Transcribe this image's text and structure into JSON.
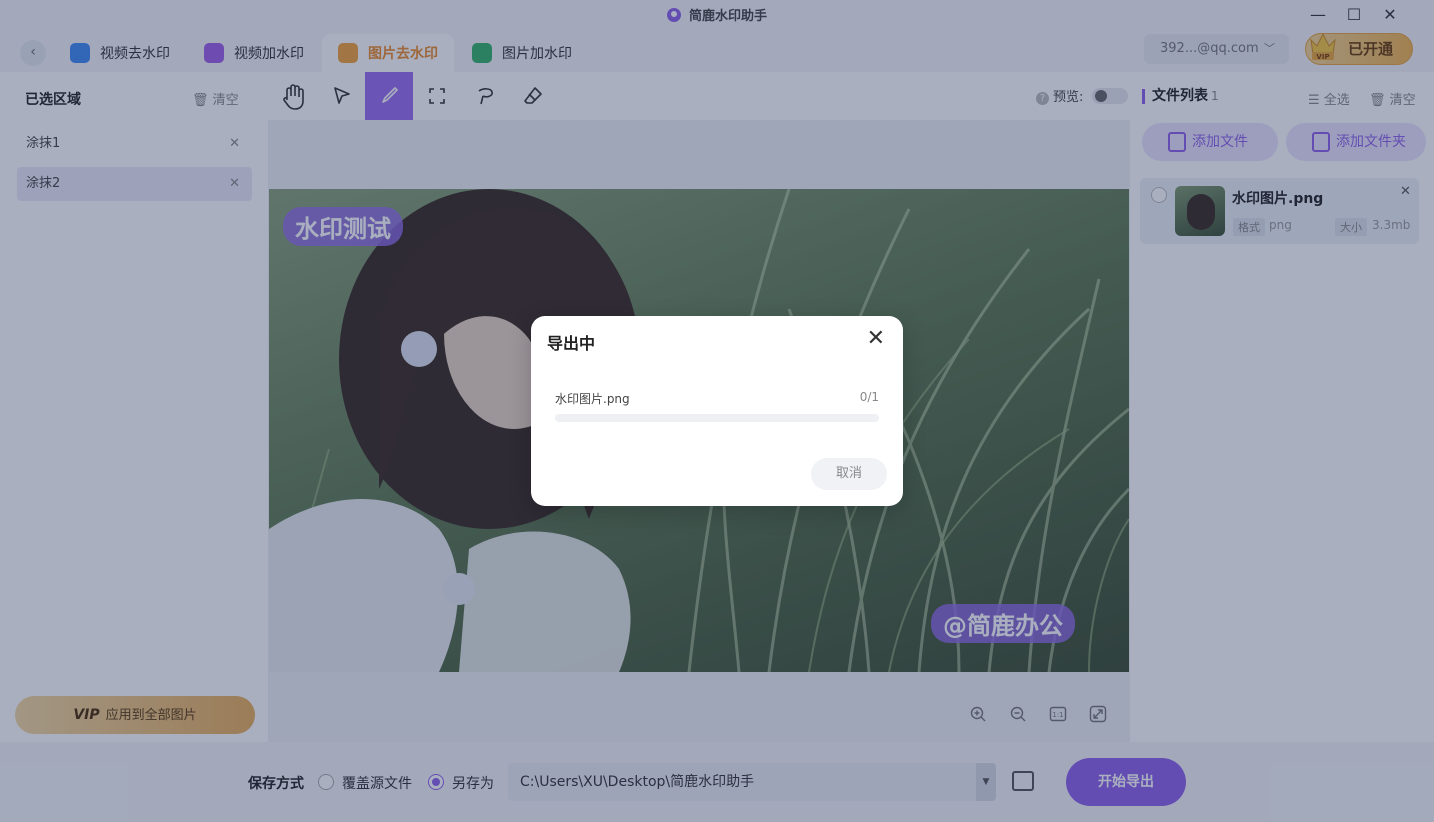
{
  "window": {
    "title": "简鹿水印助手",
    "minimize_glyph": "—",
    "maximize_glyph": "☐",
    "close_glyph": "✕"
  },
  "tabs": [
    {
      "label": "视频去水印",
      "icon": "video-remove-icon",
      "color": "#3f8cf5"
    },
    {
      "label": "视频加水印",
      "icon": "video-add-icon",
      "color": "#a05ee8"
    },
    {
      "label": "图片去水印",
      "icon": "image-remove-icon",
      "color": "#f2a43a"
    },
    {
      "label": "图片加水印",
      "icon": "image-add-icon",
      "color": "#35b36a"
    }
  ],
  "account": {
    "user": "392...@qq.com",
    "vip_label": "已开通",
    "vip_badge": "VIP"
  },
  "left_panel": {
    "title": "已选区域",
    "clear_label": "清空",
    "items": [
      {
        "label": "涂抹1"
      },
      {
        "label": "涂抹2"
      }
    ],
    "apply_vip": "VIP",
    "apply_label": "应用到全部图片"
  },
  "toolbar": {
    "tools": [
      "hand-icon",
      "pointer-icon",
      "brush-icon",
      "select-frame-icon",
      "lasso-icon",
      "eraser-icon"
    ],
    "active_tool": "brush-icon",
    "preview_label": "预览:",
    "preview_on": false
  },
  "canvas": {
    "watermarks": [
      "水印测试",
      "@简鹿办公"
    ],
    "zoom_tools": [
      "zoom-in-icon",
      "zoom-out-icon",
      "actual-size-icon",
      "fit-screen-icon"
    ],
    "actual_size_text": "1:1"
  },
  "right_panel": {
    "title": "文件列表",
    "count": "1",
    "select_all": "全选",
    "clear_label": "清空",
    "add_file": "添加文件",
    "add_folder": "添加文件夹",
    "files": [
      {
        "name": "水印图片.png",
        "format_tag": "格式",
        "format": "png",
        "size_tag": "大小",
        "size": "3.3mb"
      }
    ]
  },
  "bottom": {
    "save_mode_label": "保存方式",
    "overwrite_label": "覆盖源文件",
    "save_as_label": "另存为",
    "selected_mode": "save_as",
    "path": "C:\\Users\\XU\\Desktop\\简鹿水印助手",
    "start_label": "开始导出"
  },
  "dialog": {
    "title": "导出中",
    "file": "水印图片.png",
    "count": "0/1",
    "progress": 0,
    "cancel_label": "取消"
  },
  "colors": {
    "accent": "#8f62ec",
    "tab_active": "#ed8b2d",
    "vip_gold": "#f2b44f"
  }
}
